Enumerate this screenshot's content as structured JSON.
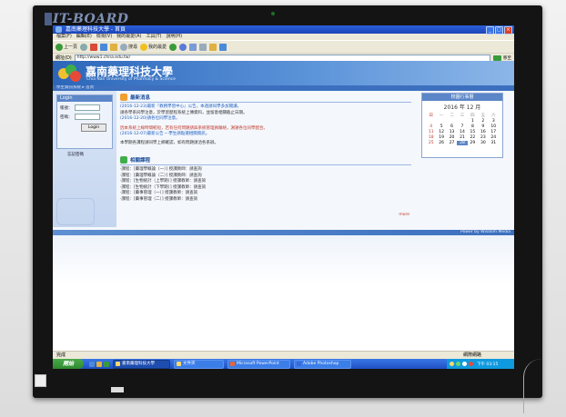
{
  "monitor": {
    "brand": "IT-BOARD"
  },
  "window": {
    "title": "嘉南藥理科技大學 - 首頁",
    "menu": [
      "檔案(F)",
      "編輯(E)",
      "檢視(V)",
      "我的最愛(A)",
      "工具(T)",
      "說明(H)"
    ],
    "toolbar": {
      "back": "上一頁",
      "search": "搜尋",
      "favorites": "我的最愛"
    },
    "address_label": "網址(D)",
    "address_value": "http://www1.chna.edu.tw/",
    "go_label": "移至"
  },
  "site": {
    "title": "嘉南藥理科技大學",
    "subtitle": "Chia Nan University of Pharmacy & Science",
    "breadcrumb": "學生資訊系統 ▸ 首頁",
    "login": {
      "header": "Login",
      "user_label": "帳號：",
      "password_label": "密碼：",
      "button": "Login",
      "link": "忘記密碼"
    },
    "news_heading": "最新消息",
    "news": [
      "(2016-12-23)最新『教務學習中心』公告，本週請同學多加閱讀。",
      "請各學系同學注意，於學習歷程系統上傳資料，並留意相關截止日期。",
      "(2016-12-20)請各位同學注意。",
      "因本系統上線時間較短，若有任何問題請與系統管理員聯絡，謝謝各位同學配合。",
      "(2016-12-07)最新公告 ─ 學生請點選相關資訊。",
      "本學期各課程請同學上網確認，如有問題請洽各系辦。"
    ],
    "more": "more",
    "course_heading": "相關課程",
    "courses": [
      "‧課程：[藥理學概論（一）] 授課教師：請查詢",
      "‧課程：[藥理學概論（二）] 授課教師：請查詢",
      "‧課程：[生物統計（上學期）] 授課教師：請查詢",
      "‧課程：[生物統計（下學期）] 授課教師：請查詢",
      "‧課程：[藥事管理（一）] 授課教師：請查詢",
      "‧課程：[藥事管理（二）] 授課教師：請查詢"
    ],
    "calendar": {
      "header": "校園行事曆",
      "date": "2016 年 12 月",
      "weekdays": [
        "日",
        "一",
        "二",
        "三",
        "四",
        "五",
        "六"
      ],
      "days": [
        "",
        "",
        "",
        "",
        "1",
        "2",
        "3",
        "4",
        "5",
        "6",
        "7",
        "8",
        "9",
        "10",
        "11",
        "12",
        "13",
        "14",
        "15",
        "16",
        "17",
        "18",
        "19",
        "20",
        "21",
        "22",
        "23",
        "24",
        "25",
        "26",
        "27",
        "28",
        "29",
        "30",
        "31"
      ],
      "today": "28"
    },
    "footer": "Power by Wisdom Media"
  },
  "status": {
    "left": "完成",
    "zone": "網際網路"
  },
  "taskbar": {
    "start": "開始",
    "tasks": [
      "嘉南藥理科技大學",
      "文件夾",
      "Microsoft PowerPoint",
      "Adobe Photoshop"
    ],
    "clock": "下午 03:15"
  },
  "colors": {
    "titlebar": "#2a5fd8",
    "banner": "#2c66b9",
    "taskbar": "#1f4fc2",
    "start": "#2e8a2e"
  }
}
